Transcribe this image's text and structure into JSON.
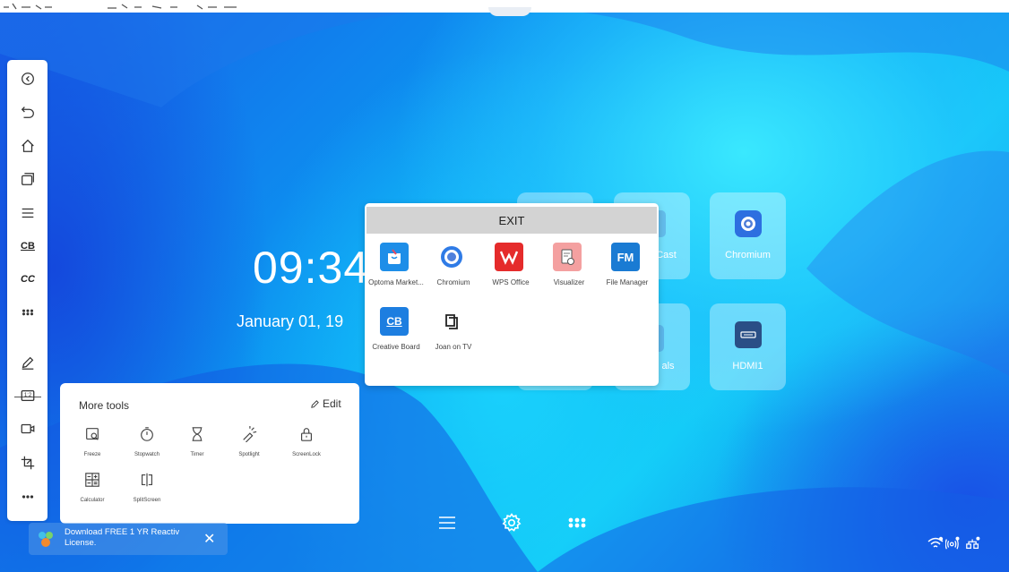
{
  "clock": {
    "time": "09:34",
    "date": "January 01, 19"
  },
  "tiles": [
    {
      "label": ""
    },
    {
      "label": "Cast"
    },
    {
      "label": "Chromium"
    },
    {
      "label": ""
    },
    {
      "label": "als"
    },
    {
      "label": "HDMI1"
    }
  ],
  "apps_dialog": {
    "exit_label": "EXIT",
    "apps": [
      {
        "label": "Optoma Market...",
        "icon": "optoma-marketplace-icon",
        "color": "#1e8ee8"
      },
      {
        "label": "Chromium",
        "icon": "chromium-icon",
        "color": "#2f7be6"
      },
      {
        "label": "WPS Office",
        "icon": "wps-office-icon",
        "color": "#e52b2b"
      },
      {
        "label": "Visualizer",
        "icon": "visualizer-icon",
        "color": "#f29a9a"
      },
      {
        "label": "File Manager",
        "icon": "file-manager-icon",
        "color": "#1a7bd3"
      },
      {
        "label": "Creative Board",
        "icon": "creative-board-icon",
        "color": "#1d7ee0",
        "badge": "CB"
      },
      {
        "label": "Joan on TV",
        "icon": "joan-on-tv-icon",
        "color": "#222222"
      }
    ]
  },
  "more_tools": {
    "title": "More tools",
    "edit_label": "Edit",
    "tools": [
      {
        "label": "Freeze",
        "icon": "freeze-icon"
      },
      {
        "label": "Stopwatch",
        "icon": "stopwatch-icon"
      },
      {
        "label": "Timer",
        "icon": "timer-icon"
      },
      {
        "label": "Spotlight",
        "icon": "spotlight-icon"
      },
      {
        "label": "ScreenLock",
        "icon": "screenlock-icon"
      },
      {
        "label": "Calculator",
        "icon": "calculator-icon"
      },
      {
        "label": "SplitScreen",
        "icon": "splitscreen-icon"
      }
    ]
  },
  "notification": {
    "text": "Download FREE 1 YR Reactiv License.",
    "close": "✕"
  },
  "sidebar": {
    "cb_label": "CB",
    "cc_label": "CC",
    "zoom_label": "1:2"
  },
  "colors": {
    "accent": "#1e8ee8",
    "panel": "#ffffff"
  }
}
